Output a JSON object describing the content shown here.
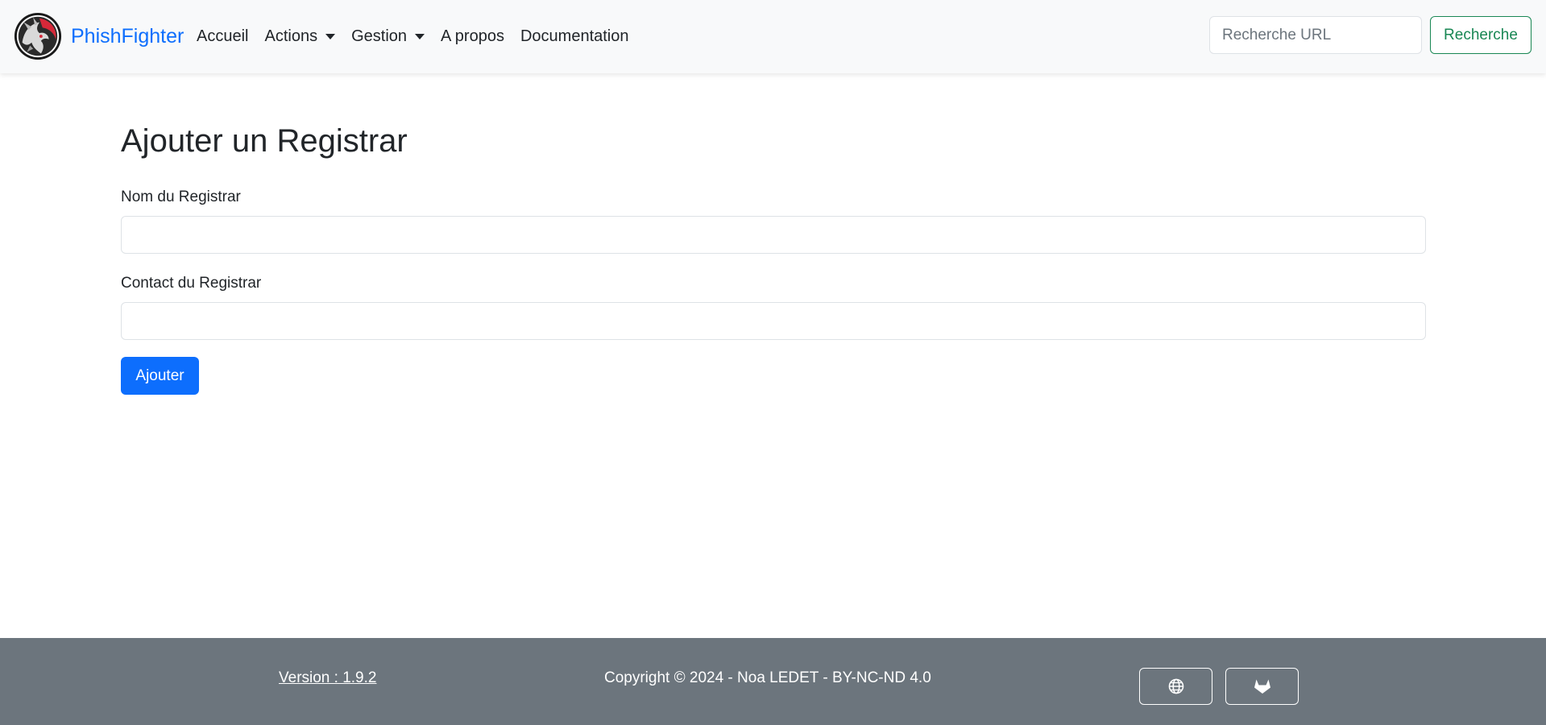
{
  "navbar": {
    "brand_name": "PhishFighter",
    "logo_icon": "dragon-logo-icon",
    "links": [
      {
        "label": "Accueil",
        "dropdown": false
      },
      {
        "label": "Actions",
        "dropdown": true
      },
      {
        "label": "Gestion",
        "dropdown": true
      },
      {
        "label": "A propos",
        "dropdown": false
      },
      {
        "label": "Documentation",
        "dropdown": false
      }
    ],
    "search": {
      "placeholder": "Recherche URL",
      "value": "",
      "button_label": "Recherche"
    }
  },
  "main": {
    "title": "Ajouter un Registrar",
    "fields": [
      {
        "label": "Nom du Registrar",
        "value": ""
      },
      {
        "label": "Contact du Registrar",
        "value": ""
      }
    ],
    "submit_label": "Ajouter"
  },
  "footer": {
    "version": "Version : 1.9.2",
    "copyright": "Copyright © 2024 - Noa LEDET - BY-NC-ND 4.0",
    "buttons": [
      {
        "icon": "globe-icon"
      },
      {
        "icon": "gitlab-icon"
      }
    ]
  },
  "colors": {
    "primary": "#0d6efd",
    "success": "#198754",
    "navbar_bg": "#f8f9fa",
    "footer_bg": "#6c757d"
  }
}
